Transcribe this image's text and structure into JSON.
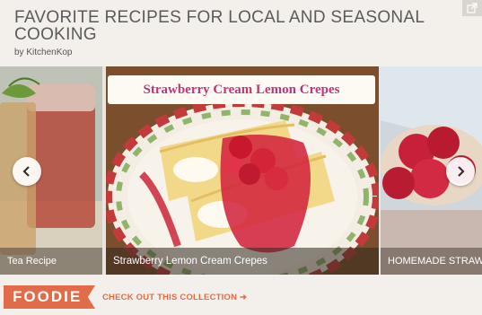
{
  "header": {
    "title": "FAVORITE RECIPES FOR LOCAL AND SEASONAL COOKING",
    "byline": "by KitchenKop"
  },
  "carousel": {
    "slides": [
      {
        "caption": "Tea Recipe"
      },
      {
        "caption": "Strawberry Lemon Cream Crepes",
        "banner": "Strawberry Cream Lemon Crepes"
      },
      {
        "caption": "HOMEMADE STRAW"
      }
    ],
    "prev_icon": "chevron-left-icon",
    "next_icon": "chevron-right-icon"
  },
  "footer": {
    "brand": "FOODIE",
    "cta": "CHECK OUT THIS COLLECTION",
    "cta_arrow": "➜",
    "brand_color": "#e16c4a"
  },
  "share_icon": "share-icon"
}
